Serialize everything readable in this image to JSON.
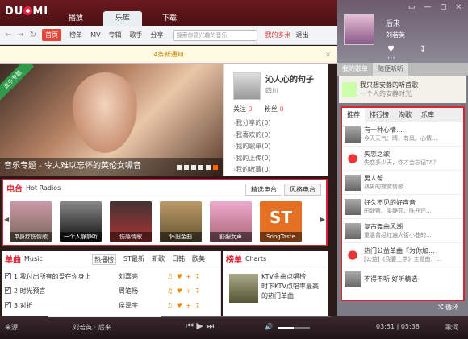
{
  "app": {
    "logo": "DU",
    "logo_rest": "MI"
  },
  "main_tabs": [
    {
      "label": "播放"
    },
    {
      "label": "乐库"
    },
    {
      "label": "下载"
    }
  ],
  "nav": {
    "back": "←",
    "forward": "→",
    "refresh": "↻",
    "links": [
      "首页",
      "榜单",
      "MV",
      "专辑",
      "歌手",
      "分享"
    ],
    "search_placeholder": "搜索你感兴趣的音乐",
    "my_page": "我的多米",
    "logout": "退出"
  },
  "notice": {
    "text": "4条新通知",
    "close": "×"
  },
  "banner": {
    "ribbon": "音乐专题",
    "caption": "音乐专题 - 令人难以忘怀的英伦女嗓音"
  },
  "profile": {
    "name": "沁人心的句子",
    "location": "四川",
    "follow_label": "关注",
    "follow_count": "0",
    "fans_label": "粉丝",
    "fans_count": "0",
    "items": [
      "我分享的(0)",
      "我喜欢的(0)",
      "我的歌单(0)",
      "我的上传(0)",
      "我的收藏(0)"
    ]
  },
  "radio": {
    "title": "电台",
    "subtitle": "Hot Radios",
    "tabs": [
      "精选电台",
      "风格电台"
    ],
    "items": [
      "单身疗伤情歌",
      "一个人静静听",
      "伤感情歌",
      "怀旧金曲",
      "舒服女声",
      "SongTaste"
    ],
    "st": "ST"
  },
  "single": {
    "title": "单曲",
    "subtitle": "Music",
    "tabs": [
      "热播榜",
      "ST最新",
      "新歌",
      "日韩",
      "欧美"
    ],
    "rows": [
      {
        "song": "1.我付出所有的爱在你身上",
        "artist": "刘嘉亮"
      },
      {
        "song": "2.时光预言",
        "artist": "周笔畅"
      },
      {
        "song": "3.对折",
        "artist": "侯泽宇"
      }
    ],
    "ops": "♫ ♥ + ↧"
  },
  "charts": {
    "title": "榜单",
    "subtitle": "Charts",
    "line1": "KTV金曲点唱榜",
    "line2": "时下KTV点唱率最高",
    "line3": "的热门单曲"
  },
  "right": {
    "song": "后来",
    "artist": "刘若英",
    "win_ctrls": "▭ — ▢ ×",
    "actions": "♥ ↧ ⋯",
    "tabs": [
      "我的歌单",
      "随便听听"
    ],
    "selected": {
      "title": "我只想安静的听首歌",
      "sub": "一个人的安静时光"
    },
    "box_tabs": [
      "推荐",
      "排行榜",
      "淘歌",
      "乐库"
    ],
    "box_items": [
      {
        "title": "有一种心情....",
        "sub": "今天天气：晴，有风。心情..."
      },
      {
        "title": "失恋之歌",
        "sub": "失恋多少天，你才会忘记TA？"
      },
      {
        "title": "男人帮",
        "sub": "熟男的寂寞情歌"
      },
      {
        "title": "好久不见的好声音",
        "sub": "田馥甄、梁静茹、陈升还..."
      },
      {
        "title": "复古舞曲风潮",
        "sub": "重温曾经红遍大街小巷的..."
      },
      {
        "title": "热门公益单曲『为你加...",
        "sub": "[公益]《我要上学》主题曲，..."
      },
      {
        "title": "不得不听 好听精选",
        "sub": ""
      }
    ],
    "loop": "⤭ 循环"
  },
  "player": {
    "source_label": "来源",
    "now_playing": "刘若英 · 后来",
    "controls": "⏮ ▶ ⏭",
    "volume_icon": "🔊",
    "time": "03:51 | 05:38",
    "lyrics": "歌词"
  }
}
